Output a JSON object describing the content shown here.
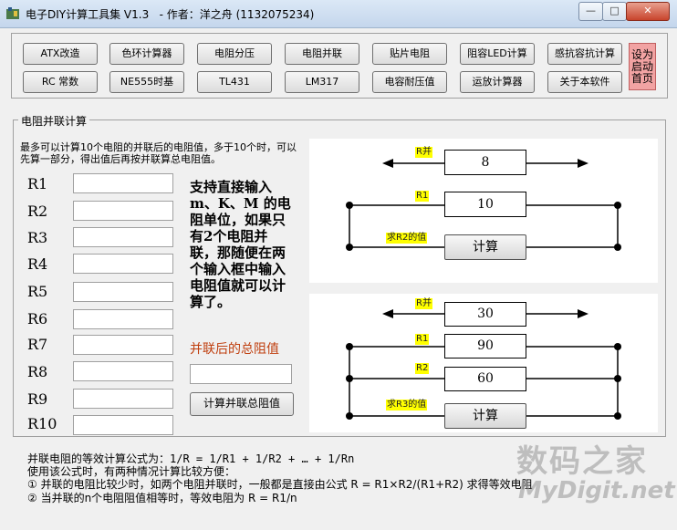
{
  "window": {
    "title": "电子DIY计算工具集 V1.3   - 作者：洋之舟 (1132075234)",
    "controls": {
      "minimize": "—",
      "maximize": "□",
      "close": "✕"
    }
  },
  "toolbar": {
    "row1": [
      "ATX改造",
      "色环计算器",
      "电阻分压",
      "电阻并联",
      "贴片电阻",
      "阻容LED计算",
      "感抗容抗计算"
    ],
    "row2": [
      "RC 常数",
      "NE555时基",
      "TL431",
      "LM317",
      "电容耐压值",
      "运放计算器",
      "关于本软件"
    ],
    "startup_button": "设为启动首页"
  },
  "group": {
    "title": "电阻并联计算",
    "description": "最多可以计算10个电阻的并联后的电阻值，多于10个时，可以先算一部分，得出值后再按并联算总电阻值。",
    "resistors": [
      "R1",
      "R2",
      "R3",
      "R4",
      "R5",
      "R6",
      "R7",
      "R8",
      "R9",
      "R10"
    ],
    "hint": "支持直接输入m、K、M 的电阻单位，如果只有2个电阻并联，那随便在两个输入框中输入电阻值就可以计算了。",
    "result_label": "并联后的总阻值",
    "calc_total_button": "计算并联总阻值"
  },
  "diagram1": {
    "total_tag": "R并",
    "total_value": "8",
    "r1_tag": "R1",
    "r1_value": "10",
    "solve_tag": "求R2的值",
    "button": "计算"
  },
  "diagram2": {
    "total_tag": "R并",
    "total_value": "30",
    "r1_tag": "R1",
    "r1_value": "90",
    "r2_tag": "R2",
    "r2_value": "60",
    "solve_tag": "求R3的值",
    "button": "计算"
  },
  "footer": {
    "formula": "并联电阻的等效计算公式为：1/R = 1/R1 + 1/R2 + … + 1/Rn",
    "intro": "使用该公式时，有两种情况计算比较方便：",
    "case1": "① 并联的电阻比较少时，如两个电阻并联时，一般都是直接由公式 R = R1×R2/(R1+R2) 求得等效电阻",
    "case2": "② 当并联的n个电阻阻值相等时，等效电阻为 R = R1/n"
  },
  "watermark": {
    "cn": "数码之家",
    "en": "MyDigit.net"
  },
  "colors": {
    "tag_bg": "#ffff00",
    "result_label": "#c04010",
    "startup_bg": "#f2a3a3"
  }
}
